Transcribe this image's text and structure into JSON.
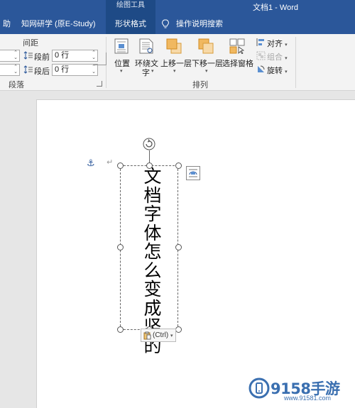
{
  "window": {
    "context_group": "绘图工具",
    "title": "文档1 - Word"
  },
  "tabs": {
    "partial_left": "助",
    "cnki": "知网研学 (原E-Study)",
    "shape_format": "形状格式",
    "tell_me": "操作说明搜索"
  },
  "paragraph_group": {
    "spacing_header": "间距",
    "before_label": "段前",
    "before_value": "0 行",
    "after_label": "段后",
    "after_value": "0 行",
    "title": "段落"
  },
  "arrange_group": {
    "position": "位置",
    "wrap_text_line1": "环绕文",
    "wrap_text_line2": "字",
    "bring_forward": "上移一层",
    "send_backward": "下移一层",
    "selection_pane": "选择窗格",
    "align": "对齐",
    "group": "组合",
    "rotate": "旋转",
    "title": "排列"
  },
  "document": {
    "textbox_text": "文档字体怎么变成竖的",
    "paste_options": "(Ctrl)"
  },
  "watermark": {
    "brand": "9158手游",
    "url": "www.91581.com"
  },
  "colors": {
    "accent": "#2b579a",
    "contextual_tab": "#1e4a86",
    "ribbon_bg": "#f3f3f3",
    "canvas_bg": "#e6e6e6"
  }
}
